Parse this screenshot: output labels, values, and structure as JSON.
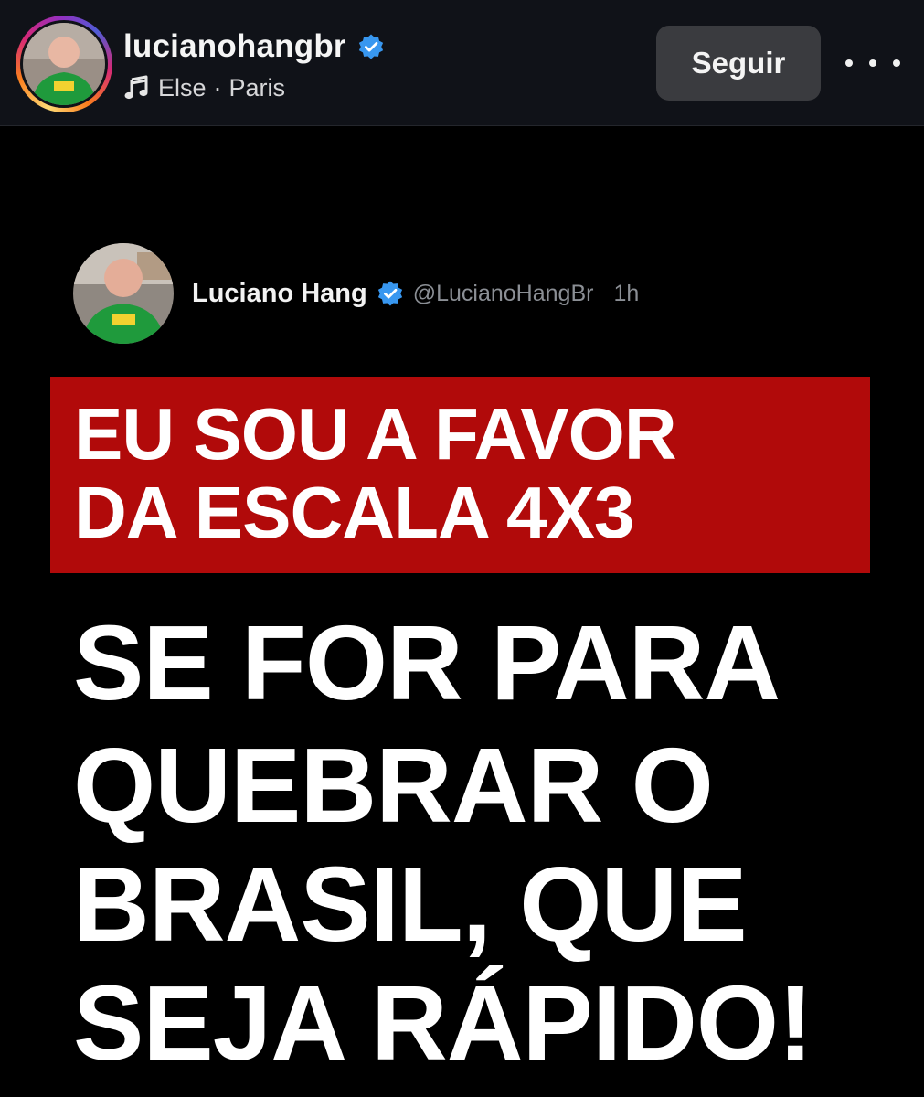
{
  "header": {
    "username": "lucianohangbr",
    "verified": true,
    "music_track": "Else",
    "separator": "·",
    "music_artist": "Paris",
    "follow_label": "Seguir",
    "more_icon": "more-horizontal-icon"
  },
  "tweet": {
    "display_name": "Luciano Hang",
    "handle": "@LucianoHangBr",
    "time": "1h",
    "verified": true
  },
  "banner": {
    "line1": "EU SOU A FAVOR",
    "line2": "DA ESCALA 4X3",
    "color": "#b10a0a"
  },
  "message": {
    "line1": "SE FOR PARA",
    "line2": "QUEBRAR O",
    "line3": "BRASIL, QUE",
    "line4": "SEJA RÁPIDO!"
  },
  "colors": {
    "header_bg": "#101218",
    "post_bg": "#000000",
    "verified_blue": "#3897f0",
    "follow_bg": "#3a3b3f",
    "shirt_green": "#1f9a3c"
  }
}
